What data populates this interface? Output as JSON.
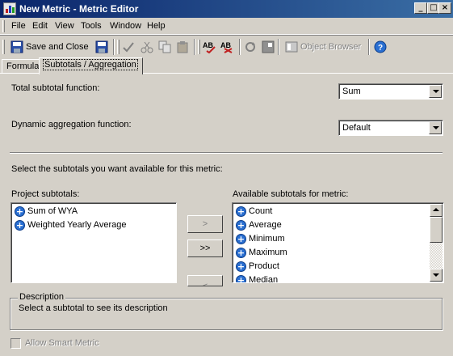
{
  "window": {
    "title": "New Metric - Metric Editor",
    "controls": {
      "minimize": "_",
      "maximize": "□",
      "close": "×"
    }
  },
  "menu": {
    "items": [
      "File",
      "Edit",
      "View",
      "Tools",
      "Window",
      "Help"
    ]
  },
  "toolbar": {
    "save_close_label": "Save and Close",
    "object_browser_label": "Object Browser",
    "icons": [
      "save-close-icon",
      "save-icon",
      "validate-icon",
      "cut-icon",
      "copy-icon",
      "paste-icon",
      "spell-check-icon",
      "find-icon",
      "refresh-icon",
      "object-browser-toggle-icon",
      "help-icon"
    ]
  },
  "tabs": [
    {
      "label": "Formula",
      "active": false
    },
    {
      "label": "Subtotals / Aggregation",
      "active": true
    }
  ],
  "form": {
    "total_subtotal_label": "Total subtotal function:",
    "total_subtotal_value": "Sum",
    "dynamic_aggregation_label": "Dynamic aggregation function:",
    "dynamic_aggregation_value": "Default",
    "select_instruction": "Select the subtotals you want available for this metric:",
    "project_subtotals_label": "Project subtotals:",
    "available_subtotals_label": "Available subtotals for metric:",
    "project_subtotals": [
      "Sum of WYA",
      "Weighted Yearly Average"
    ],
    "available_subtotals": [
      "Count",
      "Average",
      "Minimum",
      "Maximum",
      "Product",
      "Median"
    ],
    "move_one_label": ">",
    "move_all_label": ">>",
    "remove_one_label": "<",
    "description_title": "Description",
    "description_text": "Select a subtotal to see its description",
    "smart_metric_label": "Allow Smart Metric",
    "smart_metric_checked": false
  },
  "colors": {
    "titlebar_start": "#0a246a",
    "titlebar_end": "#3a6ea5",
    "face": "#d4d0c8",
    "plus_icon": "#2a6fd1"
  }
}
